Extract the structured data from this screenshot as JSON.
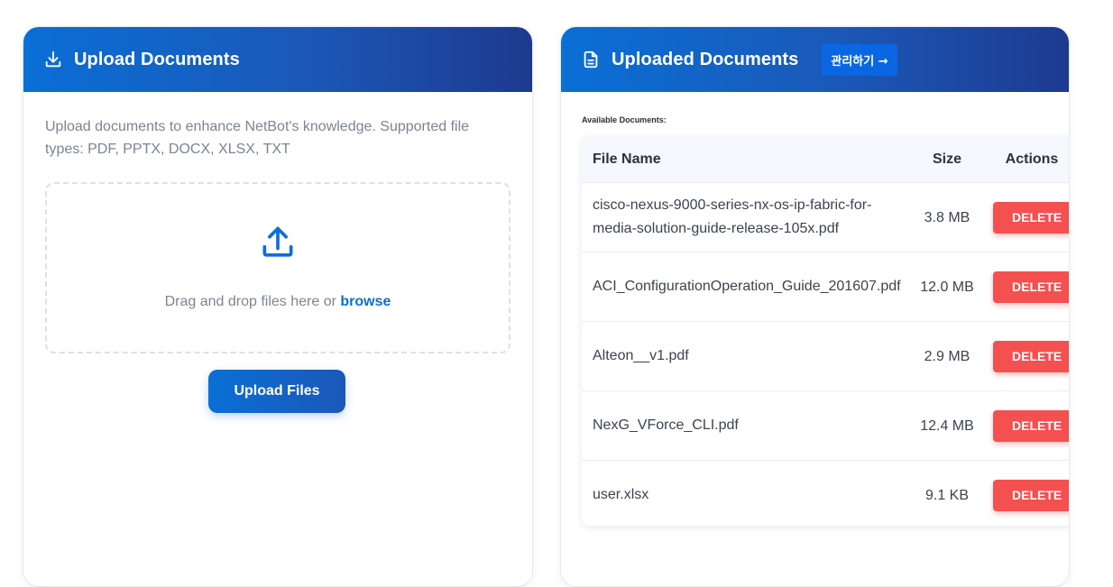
{
  "upload_card": {
    "title": "Upload Documents",
    "description": "Upload documents to enhance NetBot's knowledge. Supported file types: PDF, PPTX, DOCX, XLSX, TXT",
    "dropzone_text": "Drag and drop files here or ",
    "browse_label": "browse",
    "upload_button": "Upload Files",
    "icons": {
      "header": "download-icon",
      "dropzone": "upload-icon"
    }
  },
  "documents_card": {
    "title": "Uploaded Documents",
    "manage_button": "관리하기 →",
    "available_label": "Available Documents:",
    "columns": {
      "name": "File Name",
      "size": "Size",
      "actions": "Actions"
    },
    "delete_label": "DELETE",
    "files": [
      {
        "name": "cisco-nexus-9000-series-nx-os-ip-fabric-for-media-solution-guide-release-105x.pdf",
        "size": "3.8 MB"
      },
      {
        "name": "ACI_ConfigurationOperation_Guide_201607.pdf",
        "size": "12.0 MB"
      },
      {
        "name": "Alteon__v1.pdf",
        "size": "2.9 MB"
      },
      {
        "name": "NexG_VForce_CLI.pdf",
        "size": "12.4 MB"
      },
      {
        "name": "user.xlsx",
        "size": "9.1 KB"
      }
    ],
    "icons": {
      "header": "document-icon"
    }
  },
  "colors": {
    "header_gradient_start": "#0a6fd6",
    "header_gradient_end": "#1d3a8f",
    "accent": "#0a6fd6",
    "delete": "#f55050"
  }
}
